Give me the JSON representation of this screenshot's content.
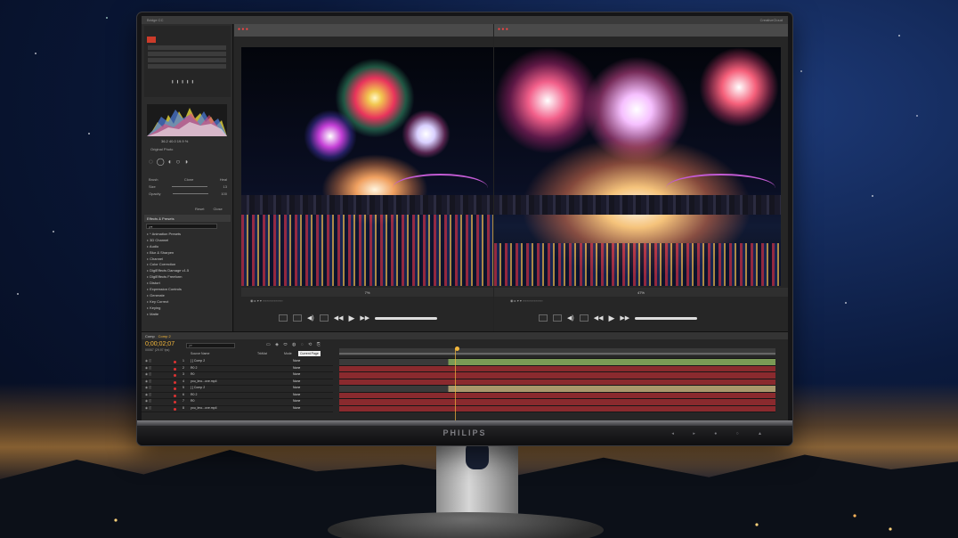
{
  "topbar": {
    "app_name": "Bridge CC",
    "corner_label": "CreativeCloud"
  },
  "left_panel": {
    "histogram_readout": "36.2   40.0   19.9 %",
    "original_photo": "Original Photo",
    "brush_labels": [
      "Brush",
      "Clone",
      "Heal"
    ],
    "size_label": "Size",
    "size_value": "13",
    "opacity_label": "Opacity",
    "opacity_value": "100",
    "reset": "Reset",
    "close": "Close",
    "effects_title": "Effects & Presets",
    "effects_search_placeholder": "ρ▾",
    "effects": [
      "* Animation Presets",
      "3D Channel",
      "Audio",
      "Blur & Sharpen",
      "Channel",
      "Color Correction",
      "DigiEffects Damage v1.5",
      "DigiEffects Freeform",
      "Distort",
      "Expression Controls",
      "Generate",
      "Key Correct",
      "Keying",
      "Matte"
    ]
  },
  "viewers": [
    {
      "zoom_label": "7%",
      "status": ""
    },
    {
      "zoom_label": "47%",
      "status": ""
    }
  ],
  "timeline": {
    "tabs": [
      "Comp",
      "Comp 2"
    ],
    "active_tab": "Comp 2",
    "timecode": "0;00;02;07",
    "frames": "00067 (29.97 fps)",
    "search_placeholder": "ρ▾",
    "columns": {
      "source_name": "Source Name",
      "parent": "Parent",
      "mode": "Mode",
      "trkmat": "TrkMat"
    },
    "tooltip": "Current Page",
    "layers": [
      {
        "num": "1",
        "name": "[ ] Comp 2",
        "parent": "None"
      },
      {
        "num": "2",
        "name": "R0 2",
        "parent": "None"
      },
      {
        "num": "3",
        "name": "R0",
        "parent": "None"
      },
      {
        "num": "4",
        "name": "you_lmo...ove.mp4",
        "parent": "None"
      },
      {
        "num": "5",
        "name": "[ ] Comp 2",
        "parent": "None"
      },
      {
        "num": "6",
        "name": "R0 2",
        "parent": "None"
      },
      {
        "num": "7",
        "name": "R0",
        "parent": "None"
      },
      {
        "num": "8",
        "name": "you_lmo...ove.mp4",
        "parent": "None"
      }
    ]
  },
  "monitor": {
    "brand": "PHILIPS",
    "chin_buttons": "◂ ▸ ● ○ ▲"
  },
  "colors": {
    "accent": "#f2b63c",
    "track_red": "#8a2a2e",
    "track_green": "#7a9a55"
  }
}
